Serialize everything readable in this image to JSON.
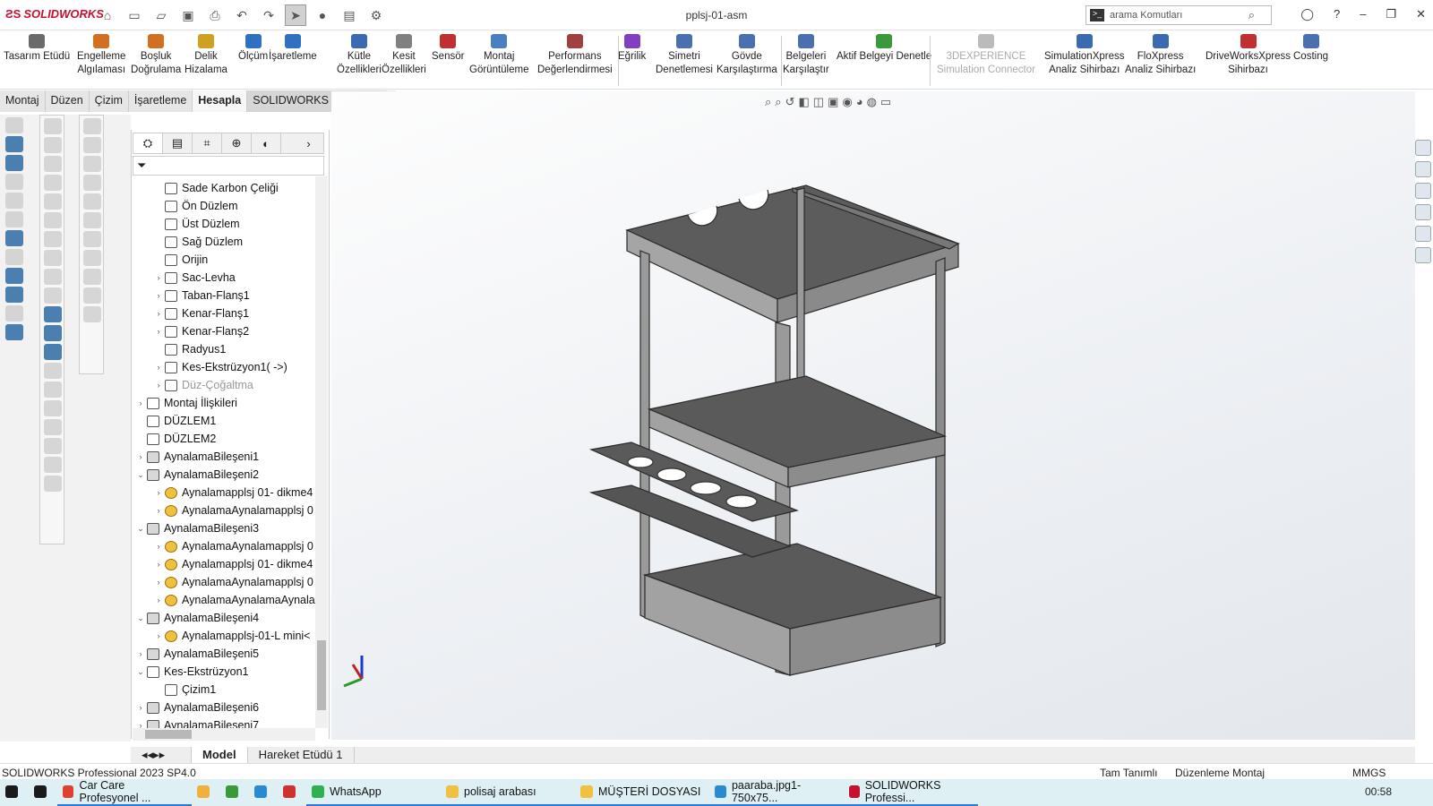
{
  "app": {
    "logo": "SOLIDWORKS",
    "doc_title": "pplsj-01-asm"
  },
  "search": {
    "placeholder": "arama Komutları"
  },
  "ribbon": [
    {
      "label": "Tasarım Etüdü",
      "color": "#6a6a6a"
    },
    {
      "label": "Engelleme\nAlgılaması",
      "color": "#d07020"
    },
    {
      "label": "Boşluk\nDoğrulama",
      "color": "#d07020"
    },
    {
      "label": "Delik\nHizalama",
      "color": "#d0a020"
    },
    {
      "label": "Ölçüm",
      "color": "#3070c0"
    },
    {
      "label": "İşaretleme",
      "color": "#3070c0"
    },
    {
      "label": "Kütle\nÖzellikleri",
      "color": "#3a6ab0"
    },
    {
      "label": "Kesit\nÖzellikleri",
      "color": "#808080"
    },
    {
      "label": "Sensör",
      "color": "#c03030"
    },
    {
      "label": "Montaj\nGörüntüleme",
      "color": "#4a80c0"
    },
    {
      "label": "Performans\nDeğerlendirmesi",
      "color": "#a04040"
    },
    {
      "label": "Eğrilik",
      "color": "#8040c0"
    },
    {
      "label": "Simetri\nDenetlemesi",
      "color": "#4a70b0"
    },
    {
      "label": "Gövde\nKarşılaştırma",
      "color": "#4a70b0"
    },
    {
      "label": "Belgeleri\nKarşılaştır",
      "color": "#4a70b0"
    },
    {
      "label": "Aktif Belgeyi Denetle",
      "color": "#3a9a3a"
    },
    {
      "label": "3DEXPERIENCE\nSimulation Connector",
      "color": "#bbbbbb"
    },
    {
      "label": "SimulationXpress\nAnaliz Sihirbazı",
      "color": "#3a6ab0"
    },
    {
      "label": "FloXpress\nAnaliz Sihirbazı",
      "color": "#3a6ab0"
    },
    {
      "label": "DriveWorksXpress\nSihirbazı",
      "color": "#c03030"
    },
    {
      "label": "Costing",
      "color": "#4a70b0"
    }
  ],
  "tabs": [
    "Montaj",
    "Düzen",
    "Çizim",
    "İşaretleme",
    "Hesapla",
    "SOLIDWORKS Eklentileri"
  ],
  "tree": [
    {
      "label": "Sade Karbon Çeliği",
      "depth": 2,
      "arrow": "",
      "icon": "material",
      "dim": false
    },
    {
      "label": "Ön Düzlem",
      "depth": 2,
      "arrow": "",
      "icon": "plane",
      "dim": false
    },
    {
      "label": "Üst Düzlem",
      "depth": 2,
      "arrow": "",
      "icon": "plane",
      "dim": false
    },
    {
      "label": "Sağ Düzlem",
      "depth": 2,
      "arrow": "",
      "icon": "plane",
      "dim": false
    },
    {
      "label": "Orijin",
      "depth": 2,
      "arrow": "",
      "icon": "origin",
      "dim": false
    },
    {
      "label": "Sac-Levha",
      "depth": 2,
      "arrow": "›",
      "icon": "feature",
      "dim": false
    },
    {
      "label": "Taban-Flanş1",
      "depth": 2,
      "arrow": "›",
      "icon": "feature",
      "dim": false
    },
    {
      "label": "Kenar-Flanş1",
      "depth": 2,
      "arrow": "›",
      "icon": "feature",
      "dim": false
    },
    {
      "label": "Kenar-Flanş2",
      "depth": 2,
      "arrow": "›",
      "icon": "feature",
      "dim": false
    },
    {
      "label": "Radyus1",
      "depth": 2,
      "arrow": "",
      "icon": "feature",
      "dim": false
    },
    {
      "label": "Kes-Ekstrüzyon1( ->)",
      "depth": 2,
      "arrow": "›",
      "icon": "feature",
      "dim": false
    },
    {
      "label": "Düz-Çoğaltma",
      "depth": 2,
      "arrow": "›",
      "icon": "feature",
      "dim": true
    },
    {
      "label": "Montaj İlişkileri",
      "depth": 1,
      "arrow": "›",
      "icon": "mates",
      "dim": false
    },
    {
      "label": "DÜZLEM1",
      "depth": 1,
      "arrow": "",
      "icon": "plane",
      "dim": false
    },
    {
      "label": "DÜZLEM2",
      "depth": 1,
      "arrow": "",
      "icon": "plane",
      "dim": false
    },
    {
      "label": "AynalamaBileşeni1",
      "depth": 1,
      "arrow": "›",
      "icon": "asm",
      "dim": false
    },
    {
      "label": "AynalamaBileşeni2",
      "depth": 1,
      "arrow": "⌄",
      "icon": "asm",
      "dim": false
    },
    {
      "label": "Aynalamapplsj 01- dikme4",
      "depth": 2,
      "arrow": "›",
      "icon": "part",
      "dim": false
    },
    {
      "label": "AynalamaAynalamapplsj 0",
      "depth": 2,
      "arrow": "›",
      "icon": "part",
      "dim": false
    },
    {
      "label": "AynalamaBileşeni3",
      "depth": 1,
      "arrow": "⌄",
      "icon": "asm",
      "dim": false
    },
    {
      "label": "AynalamaAynalamapplsj 0",
      "depth": 2,
      "arrow": "›",
      "icon": "part",
      "dim": false
    },
    {
      "label": "Aynalamapplsj 01- dikme4",
      "depth": 2,
      "arrow": "›",
      "icon": "part",
      "dim": false
    },
    {
      "label": "AynalamaAynalamapplsj 0",
      "depth": 2,
      "arrow": "›",
      "icon": "part",
      "dim": false
    },
    {
      "label": "AynalamaAynalamaAynala",
      "depth": 2,
      "arrow": "›",
      "icon": "part",
      "dim": false
    },
    {
      "label": "AynalamaBileşeni4",
      "depth": 1,
      "arrow": "⌄",
      "icon": "asm",
      "dim": false
    },
    {
      "label": "Aynalamapplsj-01-L mini<",
      "depth": 2,
      "arrow": "›",
      "icon": "part",
      "dim": false
    },
    {
      "label": "AynalamaBileşeni5",
      "depth": 1,
      "arrow": "›",
      "icon": "asm",
      "dim": false
    },
    {
      "label": "Kes-Ekstrüzyon1",
      "depth": 1,
      "arrow": "⌄",
      "icon": "feature",
      "dim": false
    },
    {
      "label": "Çizim1",
      "depth": 2,
      "arrow": "",
      "icon": "sketch",
      "dim": false
    },
    {
      "label": "AynalamaBileşeni6",
      "depth": 1,
      "arrow": "›",
      "icon": "asm",
      "dim": false
    },
    {
      "label": "AynalamaBileşeni7",
      "depth": 1,
      "arrow": "›",
      "icon": "asm",
      "dim": false
    }
  ],
  "bottom_tabs": [
    "Model",
    "Hareket Etüdü 1"
  ],
  "status": {
    "version": "SOLIDWORKS Professional 2023 SP4.0",
    "defined": "Tam Tanımlı",
    "mode": "Düzenleme Montaj",
    "units": "MMGS"
  },
  "taskbar": [
    {
      "label": "",
      "color": "#1a1a1a",
      "open": false
    },
    {
      "label": "",
      "color": "#1a1a1a",
      "open": false
    },
    {
      "label": "Car Care Profesyonel ...",
      "color": "#e04030",
      "open": true
    },
    {
      "label": "",
      "color": "#f0b040",
      "open": false
    },
    {
      "label": "",
      "color": "#3a9a3a",
      "open": false
    },
    {
      "label": "",
      "color": "#2a8ad0",
      "open": false
    },
    {
      "label": "",
      "color": "#d03030",
      "open": false
    },
    {
      "label": "WhatsApp",
      "color": "#30b050",
      "open": true
    },
    {
      "label": "polisaj arabası",
      "color": "#f0c040",
      "open": true
    },
    {
      "label": "MÜŞTERİ DOSYASI",
      "color": "#f0c040",
      "open": true
    },
    {
      "label": "paaraba.jpg1-750x75...",
      "color": "#2a8ad0",
      "open": true
    },
    {
      "label": "SOLIDWORKS Professi...",
      "color": "#c8102e",
      "open": true
    }
  ],
  "clock": "00:58"
}
